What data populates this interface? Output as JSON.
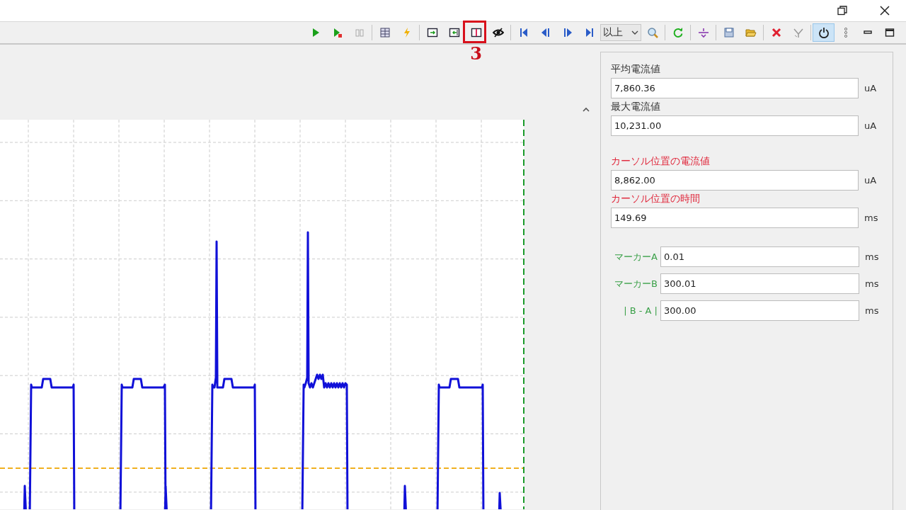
{
  "toolbar": {
    "items": [
      {
        "kind": "run",
        "pressed": false
      },
      {
        "kind": "run-flag",
        "pressed": false
      },
      {
        "kind": "pause",
        "pressed": false
      },
      {
        "kind": "sep"
      },
      {
        "kind": "table",
        "pressed": false
      },
      {
        "kind": "bolt",
        "pressed": false
      },
      {
        "kind": "sep"
      },
      {
        "kind": "frame-right",
        "pressed": false
      },
      {
        "kind": "frame-left",
        "pressed": false
      },
      {
        "kind": "split",
        "pressed": false,
        "callout": "3"
      },
      {
        "kind": "eye-off",
        "pressed": false
      },
      {
        "kind": "sep"
      },
      {
        "kind": "first",
        "pressed": false
      },
      {
        "kind": "prev",
        "pressed": false
      },
      {
        "kind": "next",
        "pressed": false
      },
      {
        "kind": "last",
        "pressed": false
      },
      {
        "kind": "select",
        "value": "以上"
      },
      {
        "kind": "zoom",
        "pressed": false
      },
      {
        "kind": "sep"
      },
      {
        "kind": "refresh",
        "pressed": false
      },
      {
        "kind": "sep"
      },
      {
        "kind": "marker",
        "pressed": false
      },
      {
        "kind": "sep"
      },
      {
        "kind": "save",
        "pressed": false
      },
      {
        "kind": "folder",
        "pressed": false
      },
      {
        "kind": "sep"
      },
      {
        "kind": "cross",
        "pressed": false
      },
      {
        "kind": "filter",
        "pressed": false
      },
      {
        "kind": "sep"
      },
      {
        "kind": "power",
        "pressed": true
      },
      {
        "kind": "dots",
        "pressed": false
      },
      {
        "kind": "minimize",
        "pressed": false
      },
      {
        "kind": "maximize",
        "pressed": false
      }
    ]
  },
  "panel": {
    "groups": [
      [
        {
          "kind": "stacked",
          "label": "平均電流値",
          "value": "7,860.36",
          "unit": "uA",
          "color": "#333333"
        },
        {
          "kind": "stacked",
          "label": "最大電流値",
          "value": "10,231.00",
          "unit": "uA",
          "color": "#333333"
        }
      ],
      [
        {
          "kind": "stacked",
          "label": "カーソル位置の電流値",
          "value": "8,862.00",
          "unit": "uA",
          "color": "#e0283c"
        },
        {
          "kind": "stacked",
          "label": "カーソル位置の時間",
          "value": "149.69",
          "unit": "ms",
          "color": "#e0283c"
        }
      ],
      [
        {
          "kind": "inline",
          "label": "マーカーA",
          "value": "0.01",
          "unit": "ms",
          "color": "#3aa048"
        },
        {
          "kind": "inline",
          "label": "マーカーB",
          "value": "300.01",
          "unit": "ms",
          "color": "#3aa048"
        },
        {
          "kind": "inline",
          "label": "| B - A |",
          "value": "300.00",
          "unit": "ms",
          "color": "#3aa048"
        }
      ]
    ]
  }
}
